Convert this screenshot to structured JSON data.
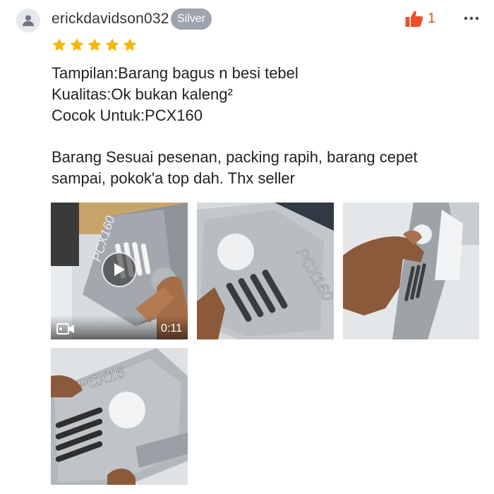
{
  "review": {
    "username": "erickdavidson032",
    "badge": "Silver",
    "like_count": "1",
    "rating": 5,
    "rating_max": 5,
    "colors": {
      "star": "#f7b500",
      "like": "#e8512c",
      "badge_bg": "#9ea4ad"
    },
    "lines": [
      "Tampilan:Barang bagus n besi tebel",
      "Kualitas:Ok bukan kaleng²",
      "Cocok Untuk:PCX160"
    ],
    "paragraph_lines": [
      "Barang Sesuai pesenan, packing rapih, barang cepet",
      "sampai, pokok'a top dah. Thx seller"
    ]
  },
  "media": {
    "video_duration": "0:11",
    "icons": {
      "avatar": "user-icon",
      "like": "thumbs-up-icon",
      "more": "more-dots-icon",
      "play": "play-icon",
      "video": "video-camera-icon"
    }
  }
}
